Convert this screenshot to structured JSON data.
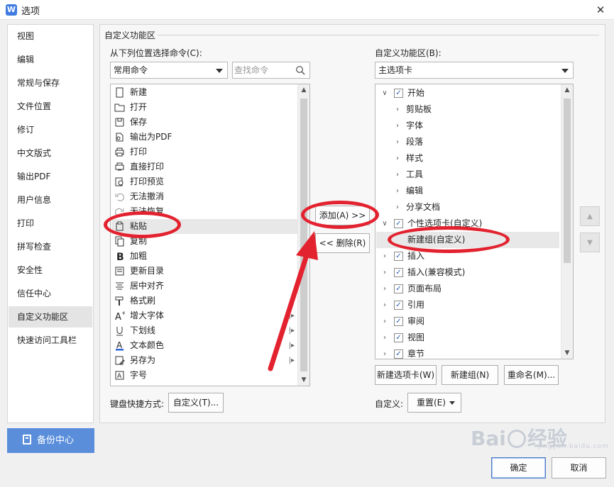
{
  "window": {
    "title": "选项",
    "app_icon": "W",
    "close_glyph": "✕"
  },
  "nav": {
    "items": [
      "视图",
      "编辑",
      "常规与保存",
      "文件位置",
      "修订",
      "中文版式",
      "输出PDF",
      "用户信息",
      "打印",
      "拼写检查",
      "安全性",
      "信任中心",
      "自定义功能区",
      "快速访问工具栏"
    ],
    "active": "自定义功能区",
    "backup_label": "备份中心"
  },
  "section": {
    "title": "自定义功能区"
  },
  "left": {
    "label": "从下列位置选择命令(C):",
    "combo_value": "常用命令",
    "search_placeholder": "查找命令",
    "commands": [
      {
        "label": "新建",
        "icon": "new-doc-icon"
      },
      {
        "label": "打开",
        "icon": "folder-open-icon"
      },
      {
        "label": "保存",
        "icon": "save-icon"
      },
      {
        "label": "输出为PDF",
        "icon": "export-pdf-icon"
      },
      {
        "label": "打印",
        "icon": "print-icon"
      },
      {
        "label": "直接打印",
        "icon": "direct-print-icon"
      },
      {
        "label": "打印预览",
        "icon": "print-preview-icon"
      },
      {
        "label": "无法撤消",
        "icon": "undo-icon"
      },
      {
        "label": "无法恢复",
        "icon": "redo-icon"
      },
      {
        "label": "粘贴",
        "icon": "paste-icon"
      },
      {
        "label": "复制",
        "icon": "copy-icon"
      },
      {
        "label": "加粗",
        "icon": "bold-icon"
      },
      {
        "label": "更新目录",
        "icon": "update-toc-icon"
      },
      {
        "label": "居中对齐",
        "icon": "align-center-icon"
      },
      {
        "label": "格式刷",
        "icon": "format-painter-icon"
      },
      {
        "label": "增大字体",
        "icon": "font-grow-icon"
      },
      {
        "label": "下划线",
        "icon": "underline-icon"
      },
      {
        "label": "文本颜色",
        "icon": "font-color-icon"
      },
      {
        "label": "另存为",
        "icon": "save-as-icon"
      },
      {
        "label": "字号",
        "icon": "font-size-icon"
      }
    ],
    "selected": "粘贴",
    "keyboard_label": "键盘快捷方式:",
    "keyboard_button": "自定义(T)..."
  },
  "middle": {
    "add_button": "添加(A) >>",
    "remove_button": "<< 删除(R)"
  },
  "right": {
    "label": "自定义功能区(B):",
    "combo_value": "主选项卡",
    "tree": [
      {
        "label": "开始",
        "level": 0,
        "expanded": true,
        "checked": true
      },
      {
        "label": "剪贴板",
        "level": 1,
        "expanded": false
      },
      {
        "label": "字体",
        "level": 1,
        "expanded": false
      },
      {
        "label": "段落",
        "level": 1,
        "expanded": false
      },
      {
        "label": "样式",
        "level": 1,
        "expanded": false
      },
      {
        "label": "工具",
        "level": 1,
        "expanded": false
      },
      {
        "label": "编辑",
        "level": 1,
        "expanded": false
      },
      {
        "label": "分享文档",
        "level": 1,
        "expanded": false
      },
      {
        "label": "个性选项卡(自定义)",
        "level": 0,
        "expanded": true,
        "checked": true
      },
      {
        "label": "新建组(自定义)",
        "level": 1,
        "leaf": true
      },
      {
        "label": "插入",
        "level": 0,
        "expanded": false,
        "checked": true
      },
      {
        "label": "插入(兼容模式)",
        "level": 0,
        "expanded": false,
        "checked": true
      },
      {
        "label": "页面布局",
        "level": 0,
        "expanded": false,
        "checked": true
      },
      {
        "label": "引用",
        "level": 0,
        "expanded": false,
        "checked": true
      },
      {
        "label": "审阅",
        "level": 0,
        "expanded": false,
        "checked": true
      },
      {
        "label": "视图",
        "level": 0,
        "expanded": false,
        "checked": true
      },
      {
        "label": "章节",
        "level": 0,
        "expanded": false,
        "checked": true
      }
    ],
    "selected": "新建组(自定义)",
    "new_tab_button": "新建选项卡(W)",
    "new_group_button": "新建组(N)",
    "rename_button": "重命名(M)...",
    "customize_label": "自定义:",
    "reset_button": "重置(E)"
  },
  "footer": {
    "ok": "确定",
    "cancel": "取消"
  },
  "watermark": {
    "brand": "Bai",
    "brand2": "经验",
    "domain": "jingyan.baidu.com"
  },
  "colors": {
    "accent": "#5a8edb",
    "annotation": "#e3222f"
  }
}
